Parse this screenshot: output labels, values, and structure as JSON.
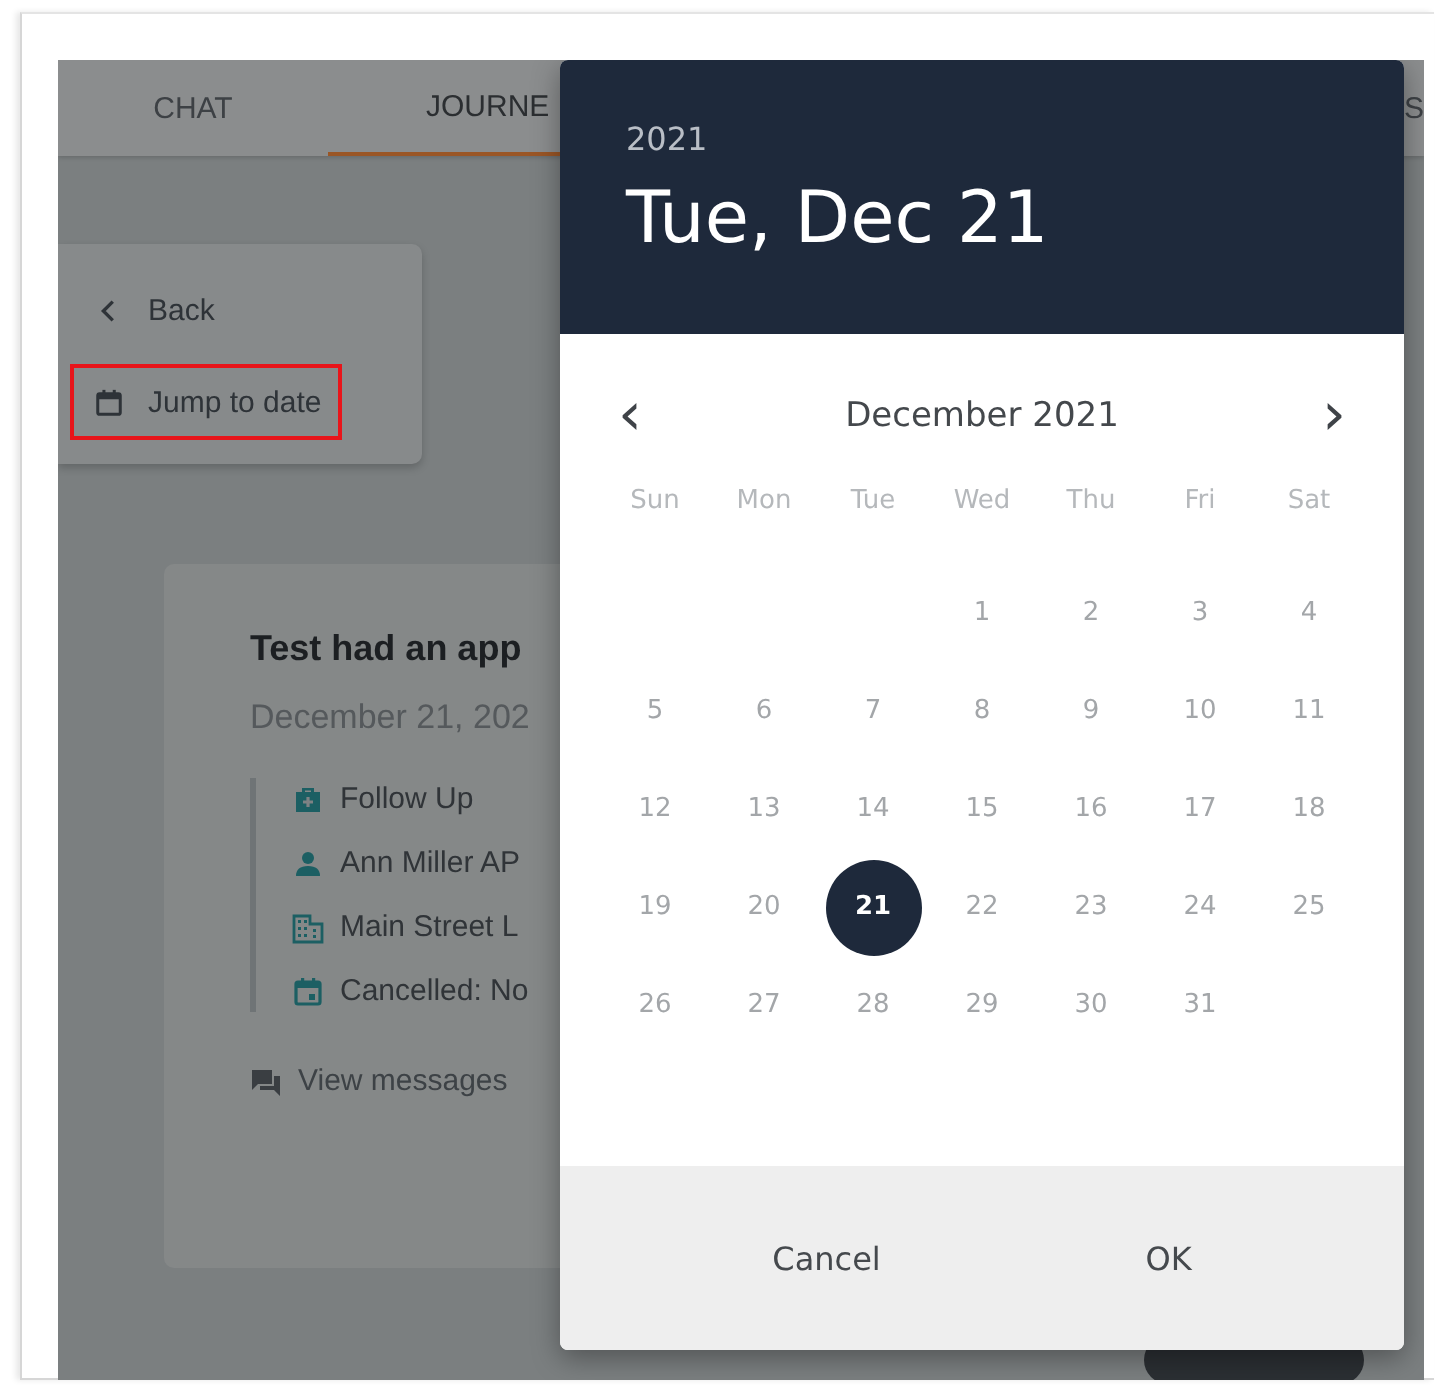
{
  "tabs": [
    {
      "label": "CHAT",
      "selected": false
    },
    {
      "label": "JOURNE",
      "selected": true
    },
    {
      "label": "S",
      "selected": false
    }
  ],
  "menu": [
    {
      "label": "Back",
      "kind": "back",
      "highlighted": false
    },
    {
      "label": "Jump to date",
      "kind": "calendar",
      "highlighted": true
    }
  ],
  "card": {
    "title": "Test had an app",
    "date": "December 21, 202",
    "details": [
      {
        "kind": "medical",
        "text": "Follow Up"
      },
      {
        "kind": "person",
        "text": "Ann Miller AP"
      },
      {
        "kind": "building",
        "text": "Main Street L"
      },
      {
        "kind": "event",
        "text": "Cancelled: No"
      }
    ],
    "link": "View messages"
  },
  "date_picker": {
    "year": "2021",
    "date": "Tue, Dec 21",
    "month": "December 2021",
    "prev": "‹",
    "next": "›",
    "weekdays": [
      "Sun",
      "Mon",
      "Tue",
      "Wed",
      "Thu",
      "Fri",
      "Sat"
    ],
    "weeks": [
      [
        {
          "kind": "blank"
        },
        {
          "kind": "blank"
        },
        {
          "kind": "blank"
        },
        {
          "day": "1",
          "selected": false
        },
        {
          "day": "2",
          "selected": false
        },
        {
          "day": "3",
          "selected": false
        },
        {
          "day": "4",
          "selected": false
        }
      ],
      [
        {
          "day": "5",
          "selected": false
        },
        {
          "day": "6",
          "selected": false
        },
        {
          "day": "7",
          "selected": false
        },
        {
          "day": "8",
          "selected": false
        },
        {
          "day": "9",
          "selected": false
        },
        {
          "day": "10",
          "selected": false
        },
        {
          "day": "11",
          "selected": false
        }
      ],
      [
        {
          "day": "12",
          "selected": false
        },
        {
          "day": "13",
          "selected": false
        },
        {
          "day": "14",
          "selected": false
        },
        {
          "day": "15",
          "selected": false
        },
        {
          "day": "16",
          "selected": false
        },
        {
          "day": "17",
          "selected": false
        },
        {
          "day": "18",
          "selected": false
        }
      ],
      [
        {
          "day": "19",
          "selected": false
        },
        {
          "day": "20",
          "selected": false
        },
        {
          "day": "21",
          "selected": true
        },
        {
          "day": "22",
          "selected": false
        },
        {
          "day": "23",
          "selected": false
        },
        {
          "day": "24",
          "selected": false
        },
        {
          "day": "25",
          "selected": false
        }
      ],
      [
        {
          "day": "26",
          "selected": false
        },
        {
          "day": "27",
          "selected": false
        },
        {
          "day": "28",
          "selected": false
        },
        {
          "day": "29",
          "selected": false
        },
        {
          "day": "30",
          "selected": false
        },
        {
          "day": "31",
          "selected": false
        },
        {
          "kind": "blank"
        }
      ]
    ],
    "buttons": [
      "Cancel",
      "OK"
    ]
  }
}
